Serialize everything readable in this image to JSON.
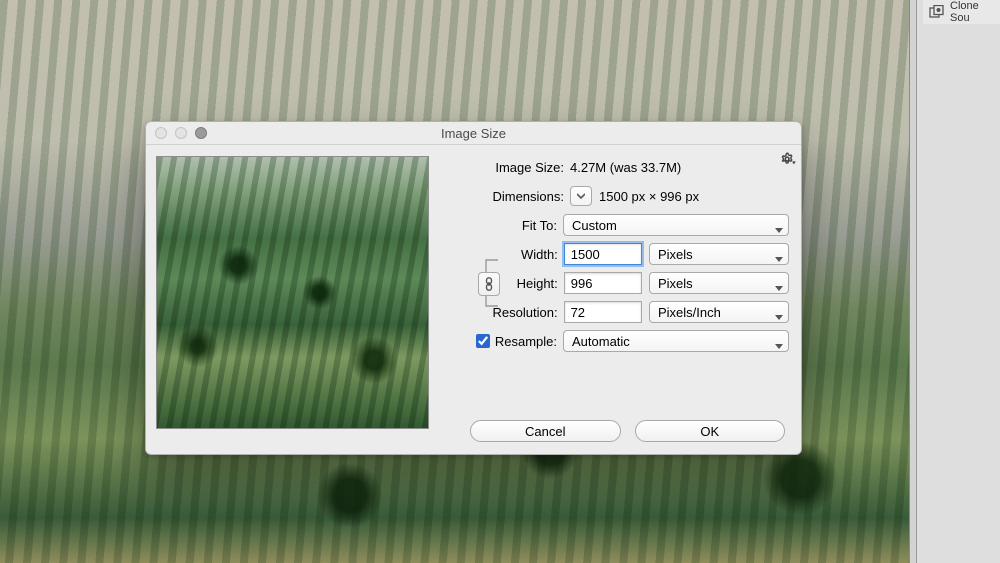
{
  "rightPanel": {
    "tabLabel": "Clone Sou"
  },
  "dialog": {
    "title": "Image Size",
    "imageSize": {
      "label": "Image Size:",
      "value": "4.27M (was 33.7M)"
    },
    "dimensions": {
      "label": "Dimensions:",
      "value": "1500 px  ×  996 px"
    },
    "fitTo": {
      "label": "Fit To:",
      "value": "Custom"
    },
    "width": {
      "label": "Width:",
      "value": "1500",
      "unit": "Pixels"
    },
    "height": {
      "label": "Height:",
      "value": "996",
      "unit": "Pixels"
    },
    "resolution": {
      "label": "Resolution:",
      "value": "72",
      "unit": "Pixels/Inch"
    },
    "resample": {
      "label": "Resample:",
      "checked": true,
      "value": "Automatic"
    },
    "buttons": {
      "cancel": "Cancel",
      "ok": "OK"
    }
  }
}
